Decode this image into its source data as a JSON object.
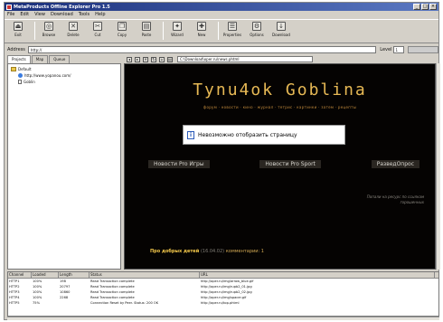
{
  "window": {
    "title": "MetaProducts Offline Explorer Pro 1.5",
    "controls": [
      "_",
      "□",
      "×"
    ]
  },
  "menu": [
    "File",
    "Edit",
    "View",
    "Download",
    "Tools",
    "Help"
  ],
  "toolbar": [
    {
      "label": "Exit",
      "icon": "exit-icon",
      "glyph": "⏏"
    },
    {
      "label": "Browse",
      "icon": "browse-icon",
      "glyph": "◎"
    },
    {
      "label": "Delete",
      "icon": "delete-icon",
      "glyph": "✕"
    },
    {
      "label": "Cut",
      "icon": "cut-icon",
      "glyph": "✂"
    },
    {
      "label": "Copy",
      "icon": "copy-icon",
      "glyph": "❐"
    },
    {
      "label": "Paste",
      "icon": "paste-icon",
      "glyph": "▤"
    },
    {
      "label": "Wizard",
      "icon": "wizard-icon",
      "glyph": "✦"
    },
    {
      "label": "New",
      "icon": "new-icon",
      "glyph": "✚"
    },
    {
      "label": "Properties",
      "icon": "properties-icon",
      "glyph": "☰"
    },
    {
      "label": "Options",
      "icon": "options-icon",
      "glyph": "⚙"
    },
    {
      "label": "Download",
      "icon": "download-icon",
      "glyph": "↓"
    }
  ],
  "address": {
    "label": "Address",
    "value": "http://",
    "level_label": "Level",
    "level_value": "1"
  },
  "tabs": [
    "Projects",
    "Map",
    "Queue"
  ],
  "tree": [
    {
      "label": "Default",
      "kind": "folder"
    },
    {
      "label": "http://www.yopanou.com/",
      "kind": "globe"
    },
    {
      "label": "Goblin",
      "kind": "doc"
    }
  ],
  "viewer": {
    "path": "C:\\Download\\oper.ru\\news.phtml",
    "site_title": "Tynu4ok Goblina",
    "site_nav": "форум · новости · кино · журнал · тетрис · картинки · затем · рецепты",
    "error_text": "Невозможно отобразить страницу",
    "menu_items": [
      "Новости Pro Игры",
      "Новости Pro Sport",
      "РазведОпрос"
    ],
    "side_note": "Попали на ресурс по ссылкам горошенных",
    "footer_title": "Про добрых детей",
    "footer_meta": "(16.04.02)",
    "footer_comments": "комментарии: 1"
  },
  "log": {
    "headers": [
      "Channel",
      "Loaded",
      "Length",
      "Status",
      "URL"
    ],
    "rows": [
      [
        "HTTP1",
        "100%",
        "198",
        "Read Transaction complete",
        "http://oper.ru/img/arrow_blue.gif"
      ],
      [
        "HTTP2",
        "100%",
        "20797",
        "Read Transaction complete",
        "http://oper.ru/img/rupb2_01.jpg"
      ],
      [
        "HTTP3",
        "100%",
        "10860",
        "Read Transaction complete",
        "http://oper.ru/img/rupb2_02.jpg"
      ],
      [
        "HTTP4",
        "100%",
        "2268",
        "Read Transaction complete",
        "http://oper.ru/img/spacer.gif"
      ],
      [
        "HTTP5",
        "75%",
        "",
        "Connection Reset by Peer. Status: 200 OK",
        "http://oper.ru/top.phtml"
      ]
    ]
  }
}
